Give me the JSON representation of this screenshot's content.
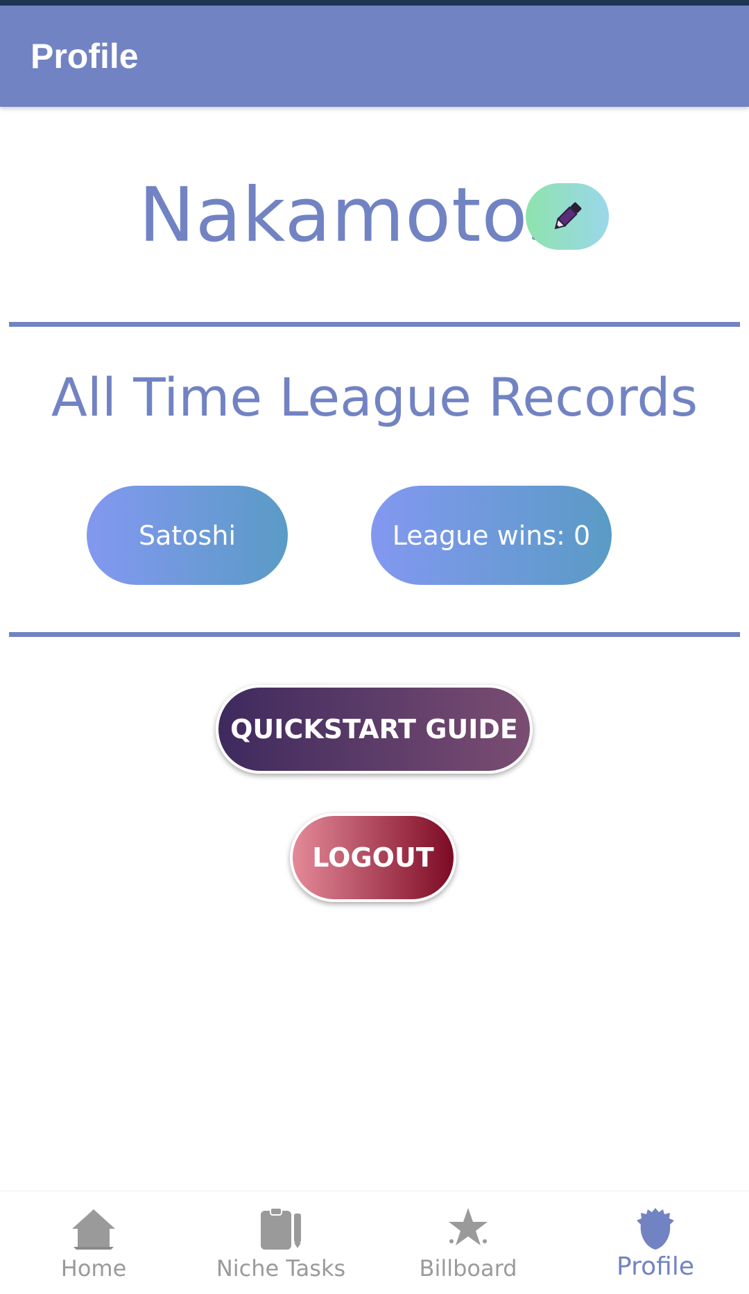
{
  "app_bar": {
    "title": "Profile"
  },
  "profile": {
    "team_name": "Nakamotos",
    "edit_icon": "pencil-icon"
  },
  "records": {
    "section_title": "All Time League Records",
    "player_name": "Satoshi",
    "league_wins": "League wins: 0"
  },
  "actions": {
    "quickstart_label": "QUICKSTART GUIDE",
    "logout_label": "LOGOUT"
  },
  "bottom_nav": {
    "items": [
      {
        "label": "Home",
        "icon": "home-icon"
      },
      {
        "label": "Niche Tasks",
        "icon": "clipboard-icon"
      },
      {
        "label": "Billboard",
        "icon": "star-icon"
      },
      {
        "label": "Profile",
        "icon": "profile-icon",
        "active": true
      }
    ]
  },
  "colors": {
    "primary": "#7283c3",
    "inactive": "#9a9a9a",
    "quickstart_gradient": [
      "#3e2a5e",
      "#7a4d72"
    ],
    "logout_gradient": [
      "#e48a99",
      "#7d0a24"
    ],
    "pill_gradient": [
      "#8398f0",
      "#5a9bc6"
    ],
    "edit_gradient": [
      "#8ee3ad",
      "#9ad7ea"
    ]
  }
}
